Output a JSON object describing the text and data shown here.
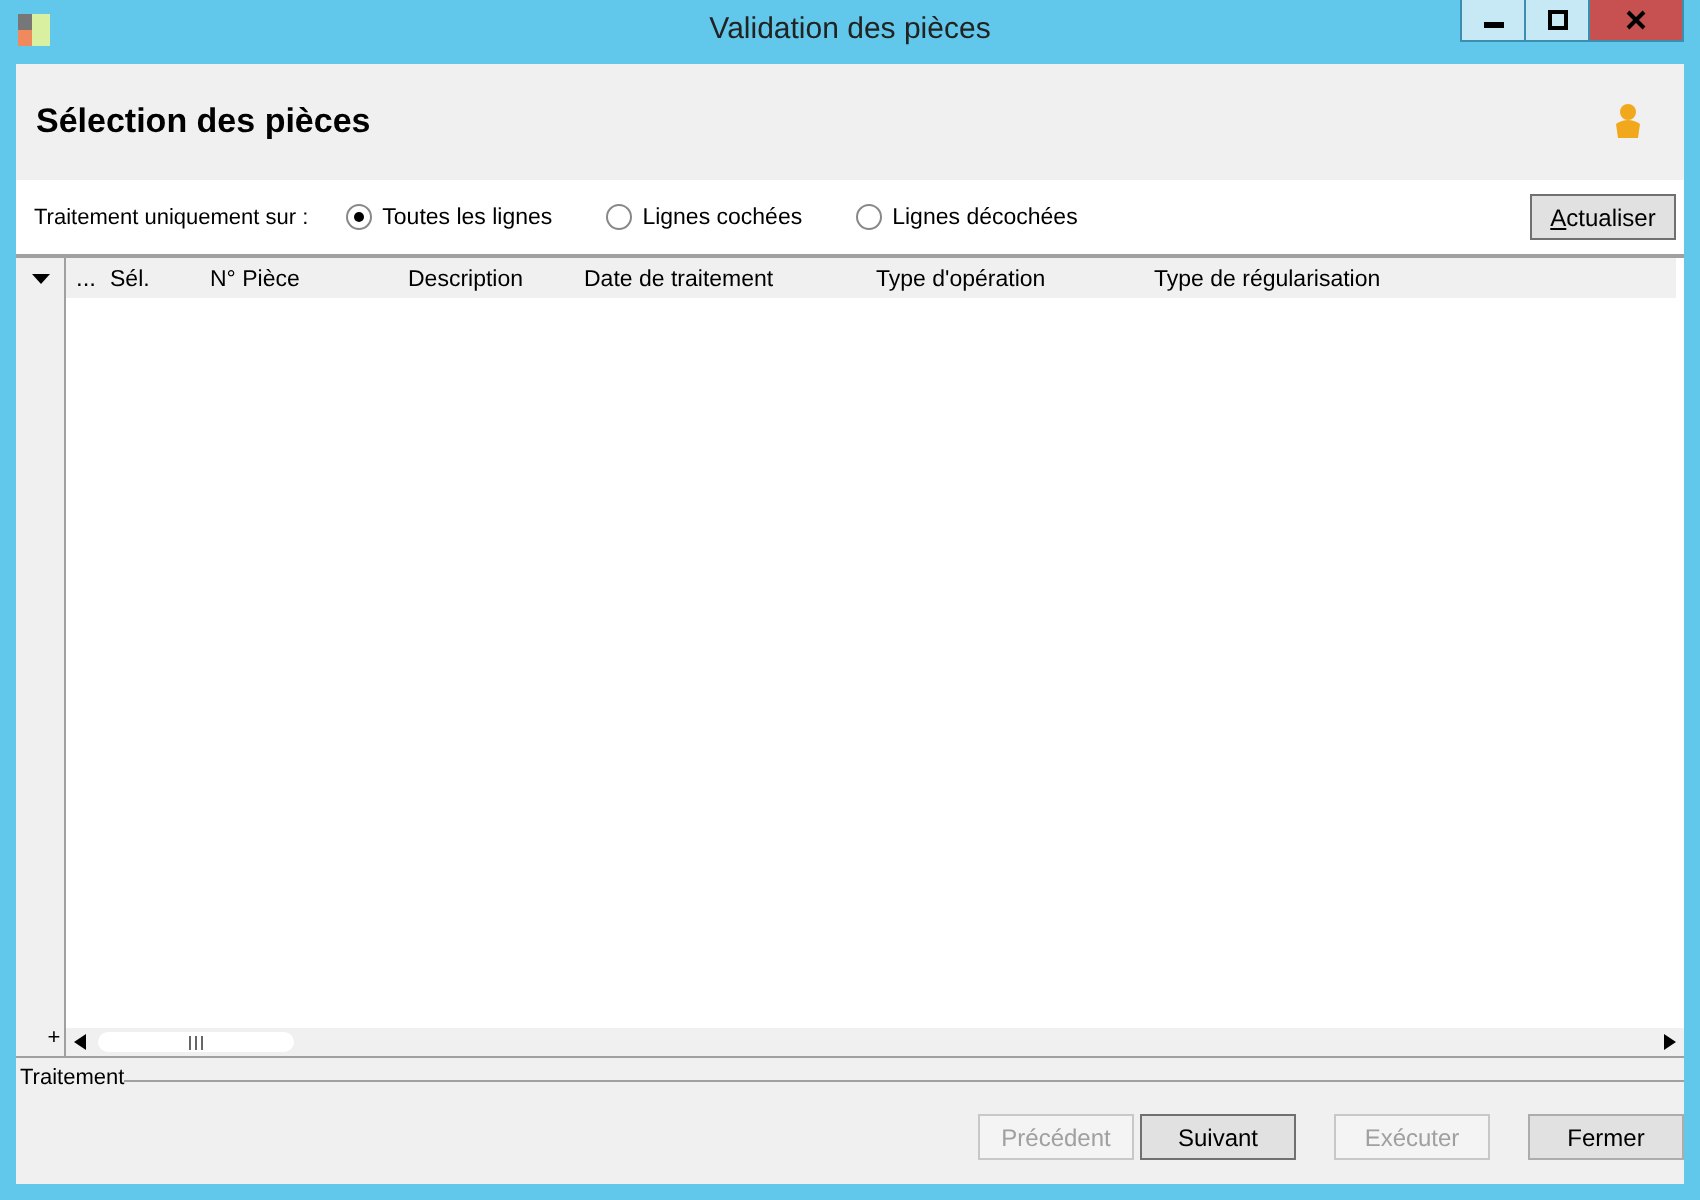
{
  "window": {
    "title": "Validation des pièces"
  },
  "header": {
    "title": "Sélection des pièces"
  },
  "filter": {
    "label": "Traitement uniquement sur :",
    "options": [
      {
        "label": "Toutes les lignes",
        "selected": true
      },
      {
        "label": "Lignes cochées",
        "selected": false
      },
      {
        "label": "Lignes décochées",
        "selected": false
      }
    ],
    "refresh_button": "Actualiser"
  },
  "grid": {
    "more": "...",
    "add": "+",
    "columns": [
      "Sél.",
      "N° Pièce",
      "Description",
      "Date de traitement",
      "Type d'opération",
      "Type de régularisation"
    ]
  },
  "group": {
    "title": "Traitement"
  },
  "buttons": [
    {
      "label": "Précédent",
      "disabled": true,
      "default": false
    },
    {
      "label": "Suivant",
      "disabled": false,
      "default": true
    },
    {
      "label": "Exécuter",
      "disabled": true,
      "default": false
    },
    {
      "label": "Fermer",
      "disabled": false,
      "default": false
    }
  ]
}
